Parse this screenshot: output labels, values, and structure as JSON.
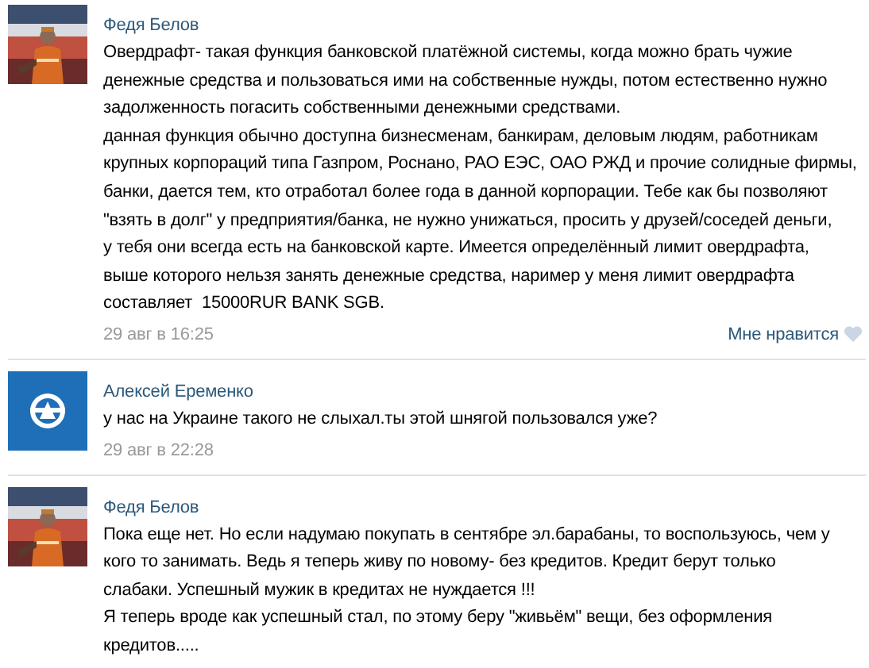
{
  "comments": [
    {
      "author": "Федя Белов",
      "avatar": {
        "kind": "picture"
      },
      "paragraphs": [
        [
          "Овердрафт- такая функция банковской платёжной системы, когда можно брать чужие",
          "денежные средства и пользоваться ими на собственные нужды, потом естественно нужно",
          "задолженность погасить собственными денежными средствами."
        ],
        [
          "данная функция обычно доступна бизнесменам, банкирам, деловым людям, работникам",
          "крупных корпораций типа Газпром, Роснано, РАО ЕЭС, ОАО РЖД и прочие солидные фирмы,",
          "банки, дается тем, кто отработал более года в данной корпорации. Тебе как бы позволяют",
          "\"взять в долг\" у предприятия/банка, не нужно унижаться, просить у друзей/соседей деньги,",
          "у тебя они всегда есть на банковской карте. Имеется определённый лимит овердрафта,",
          "выше которого нельзя занять денежные средства, наример у меня лимит овердрафта",
          "составляет  15000RUR BANK SGB."
        ]
      ],
      "date": "29 авг в 16:25",
      "like": {
        "label": "Мне нравится",
        "liked": false
      }
    },
    {
      "author": "Алексей Еременко",
      "avatar": {
        "kind": "logo"
      },
      "paragraphs": [
        [
          "у нас на Украине такого не слыхал.ты этой шнягой пользовался уже?"
        ]
      ],
      "date": "29 авг в 22:28"
    },
    {
      "author": "Федя Белов",
      "avatar": {
        "kind": "picture"
      },
      "paragraphs": [
        [
          "Пока еще нет. Но если надумаю покупать в сентябре эл.барабаны, то воспользуюсь, чем у",
          "кого то занимать. Ведь я теперь живу по новому- без кредитов. Кредит берут только",
          "слабаки. Успешный мужик в кредитах не нуждается !!!"
        ],
        [
          "Я теперь вроде как успешный стал, по этому беру \"живьём\" вещи, без оформления",
          "кредитов....."
        ]
      ]
    }
  ]
}
